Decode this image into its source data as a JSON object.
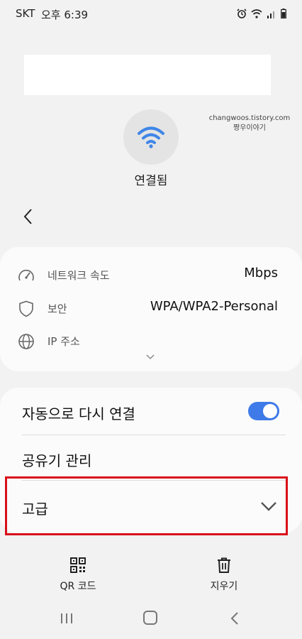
{
  "status_bar": {
    "carrier": "SKT",
    "time": "오후 6:39"
  },
  "watermark": {
    "line1": "changwoos.tistory.com",
    "line2": "짱우이야기"
  },
  "connection": {
    "status": "연결됨"
  },
  "info": {
    "network_speed": {
      "label": "네트워크 속도",
      "value": "Mbps"
    },
    "security": {
      "label": "보안",
      "value": "WPA/WPA2-Personal"
    },
    "ip": {
      "label": "IP 주소",
      "value": ""
    }
  },
  "settings": {
    "auto_reconnect": {
      "label": "자동으로 다시 연결",
      "enabled": true
    },
    "router_manage": {
      "label": "공유기 관리"
    },
    "advanced": {
      "label": "고급"
    }
  },
  "actions": {
    "qr": "QR 코드",
    "forget": "지우기"
  },
  "colors": {
    "accent": "#3e7ae8",
    "wifi_icon": "#3f86e8",
    "highlight": "#d8101a"
  }
}
